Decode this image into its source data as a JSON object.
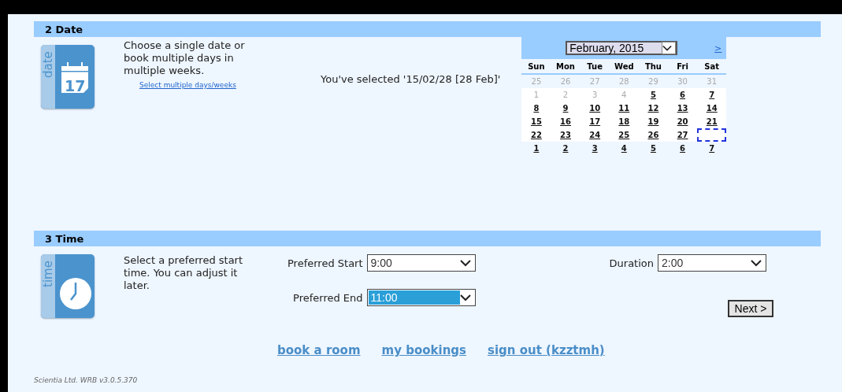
{
  "date_section": {
    "number": "2",
    "title": "Date",
    "icon_label": "date",
    "icon_day": "17",
    "description": "Choose a single date or book multiple days in multiple weeks.",
    "multi_link": "Select multiple days/weeks",
    "selection_text": "You've selected '15/02/28 [28 Feb]'",
    "calendar": {
      "month": "February, 2015",
      "next": ">",
      "weekdays": [
        "Sun",
        "Mon",
        "Tue",
        "Wed",
        "Thu",
        "Fri",
        "Sat"
      ],
      "weeks": [
        [
          {
            "label": "25",
            "kind": "prev"
          },
          {
            "label": "26",
            "kind": "prev"
          },
          {
            "label": "27",
            "kind": "prev"
          },
          {
            "label": "28",
            "kind": "prev"
          },
          {
            "label": "29",
            "kind": "prev"
          },
          {
            "label": "30",
            "kind": "prev"
          },
          {
            "label": "31",
            "kind": "prev"
          }
        ],
        [
          {
            "label": "1",
            "kind": "past"
          },
          {
            "label": "2",
            "kind": "past"
          },
          {
            "label": "3",
            "kind": "past"
          },
          {
            "label": "4",
            "kind": "past"
          },
          {
            "label": "5",
            "kind": "day"
          },
          {
            "label": "6",
            "kind": "day"
          },
          {
            "label": "7",
            "kind": "day"
          }
        ],
        [
          {
            "label": "8",
            "kind": "day"
          },
          {
            "label": "9",
            "kind": "day"
          },
          {
            "label": "10",
            "kind": "day"
          },
          {
            "label": "11",
            "kind": "day"
          },
          {
            "label": "12",
            "kind": "day"
          },
          {
            "label": "13",
            "kind": "day"
          },
          {
            "label": "14",
            "kind": "day"
          }
        ],
        [
          {
            "label": "15",
            "kind": "day"
          },
          {
            "label": "16",
            "kind": "day"
          },
          {
            "label": "17",
            "kind": "day"
          },
          {
            "label": "18",
            "kind": "day"
          },
          {
            "label": "19",
            "kind": "day"
          },
          {
            "label": "20",
            "kind": "day"
          },
          {
            "label": "21",
            "kind": "day"
          }
        ],
        [
          {
            "label": "22",
            "kind": "day"
          },
          {
            "label": "23",
            "kind": "day"
          },
          {
            "label": "24",
            "kind": "day"
          },
          {
            "label": "25",
            "kind": "day"
          },
          {
            "label": "26",
            "kind": "day"
          },
          {
            "label": "27",
            "kind": "day"
          },
          {
            "kind": "selected"
          }
        ],
        [
          {
            "label": "1",
            "kind": "next"
          },
          {
            "label": "2",
            "kind": "next"
          },
          {
            "label": "3",
            "kind": "next"
          },
          {
            "label": "4",
            "kind": "next"
          },
          {
            "label": "5",
            "kind": "next"
          },
          {
            "label": "6",
            "kind": "next"
          },
          {
            "label": "7",
            "kind": "next"
          }
        ]
      ]
    }
  },
  "time_section": {
    "number": "3",
    "title": "Time",
    "icon_label": "time",
    "description": "Select a preferred start time. You can adjust it later.",
    "start": {
      "label": "Preferred Start",
      "value": "9:00",
      "highlighted": false
    },
    "end": {
      "label": "Preferred End",
      "value": "11:00",
      "highlighted": true
    },
    "duration": {
      "label": "Duration",
      "value": "2:00",
      "highlighted": false
    },
    "next_button": "Next >"
  },
  "footer_links": [
    "book a room",
    "my bookings",
    "sign out (kzztmh)"
  ],
  "version": "Scientia Ltd. WRB v3.0.5.370"
}
